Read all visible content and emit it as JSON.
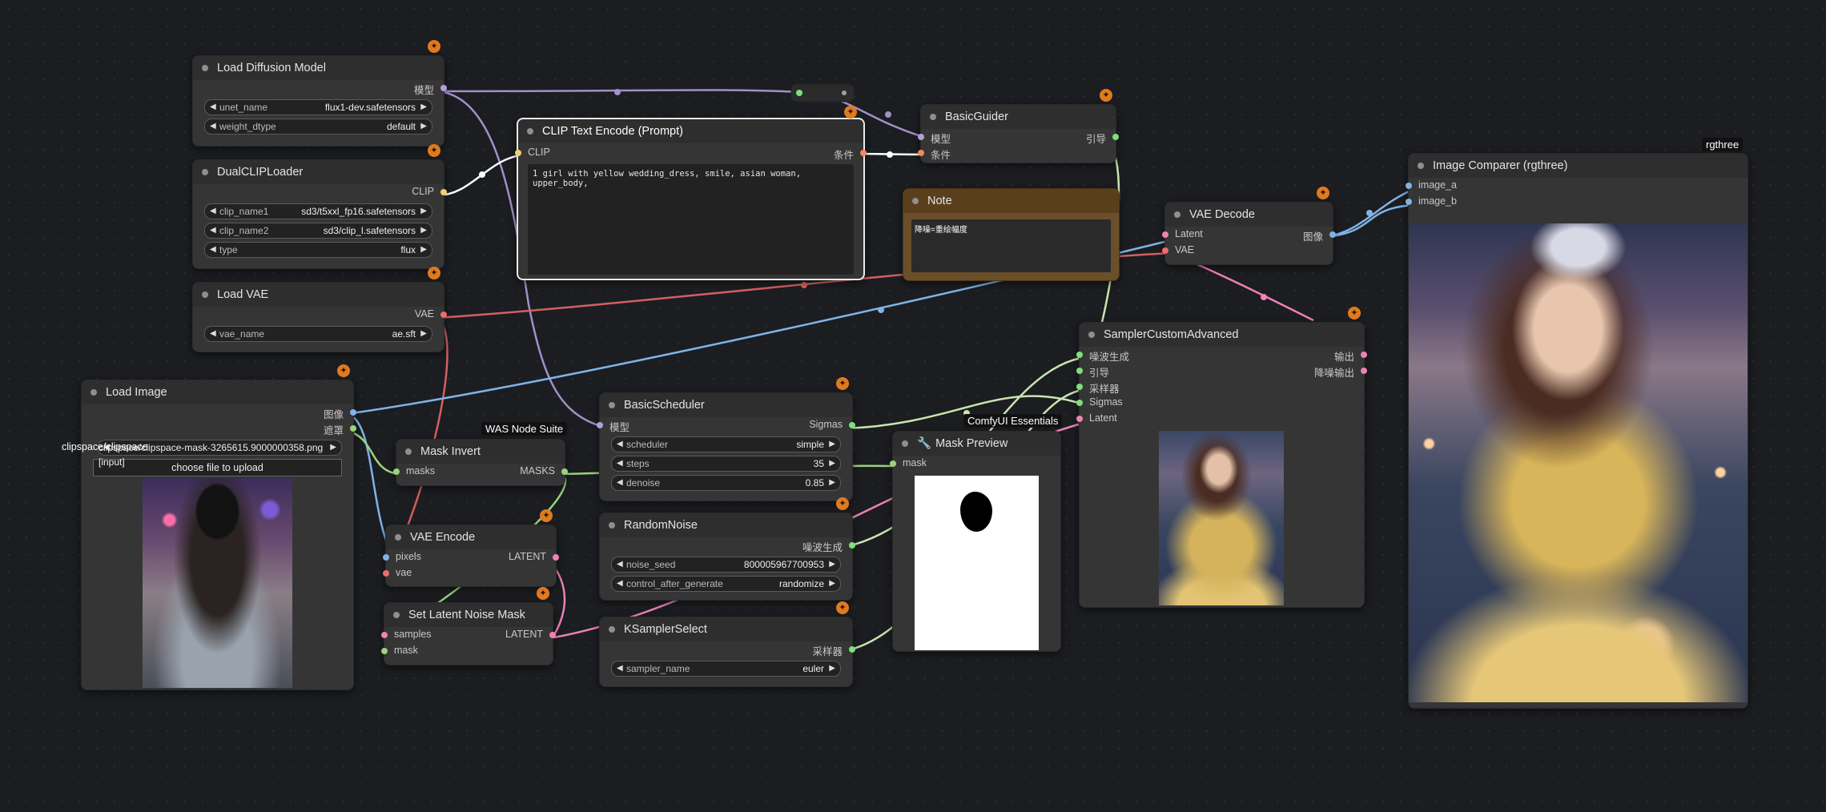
{
  "nodes": {
    "load_diffusion": {
      "title": "Load Diffusion Model",
      "out_model": "模型",
      "widgets": [
        {
          "name": "unet_name",
          "value": "flux1-dev.safetensors"
        },
        {
          "name": "weight_dtype",
          "value": "default"
        }
      ]
    },
    "dual_clip": {
      "title": "DualCLIPLoader",
      "out_clip": "CLIP",
      "widgets": [
        {
          "name": "clip_name1",
          "value": "sd3/t5xxl_fp16.safetensors"
        },
        {
          "name": "clip_name2",
          "value": "sd3/clip_l.safetensors"
        },
        {
          "name": "type",
          "value": "flux"
        }
      ]
    },
    "load_vae": {
      "title": "Load VAE",
      "out_vae": "VAE",
      "widgets": [
        {
          "name": "vae_name",
          "value": "ae.sft"
        }
      ]
    },
    "load_image": {
      "title": "Load Image",
      "out_image": "图像",
      "out_mask": "遮罩",
      "file_value": "clipspace/clipspace-mask-3265615.9000000358.png [input]",
      "file_overlap": "clipspace/clipspace",
      "upload_label": "choose file to upload"
    },
    "clip_text": {
      "title": "CLIP Text Encode (Prompt)",
      "in_clip": "CLIP",
      "out_cond": "条件",
      "text": "1 girl with yellow wedding_dress, smile, asian woman, upper_body,"
    },
    "note": {
      "title": "Note",
      "text": "降噪=重绘幅度"
    },
    "basic_guider": {
      "title": "BasicGuider",
      "in_model": "模型",
      "in_cond": "条件",
      "out_guider": "引导"
    },
    "vae_decode": {
      "title": "VAE Decode",
      "in_latent": "Latent",
      "in_vae": "VAE",
      "out_image": "图像"
    },
    "image_comparer": {
      "title": "Image Comparer (rgthree)",
      "in_a": "image_a",
      "in_b": "image_b",
      "tag": "rgthree"
    },
    "sampler_custom": {
      "title": "SamplerCustomAdvanced",
      "inputs": [
        "噪波生成",
        "引导",
        "采样器",
        "Sigmas",
        "Latent"
      ],
      "out_output": "输出",
      "out_denoised": "降噪输出",
      "tag": "ComfyUI Essentials"
    },
    "basic_scheduler": {
      "title": "BasicScheduler",
      "in_model": "模型",
      "out_sigmas": "Sigmas",
      "widgets": [
        {
          "name": "scheduler",
          "value": "simple"
        },
        {
          "name": "steps",
          "value": "35"
        },
        {
          "name": "denoise",
          "value": "0.85"
        }
      ]
    },
    "mask_invert": {
      "title": "Mask Invert",
      "in_masks": "masks",
      "out_masks": "MASKS",
      "tag": "WAS Node Suite"
    },
    "mask_preview": {
      "title": "Mask Preview",
      "in_mask": "mask"
    },
    "random_noise": {
      "title": "RandomNoise",
      "out_noise": "噪波生成",
      "widgets": [
        {
          "name": "noise_seed",
          "value": "800005967700953"
        },
        {
          "name": "control_after_generate",
          "value": "randomize"
        }
      ]
    },
    "vae_encode": {
      "title": "VAE Encode",
      "in_pixels": "pixels",
      "in_vae": "vae",
      "out_latent": "LATENT"
    },
    "set_latent_mask": {
      "title": "Set Latent Noise Mask",
      "in_samples": "samples",
      "in_mask": "mask",
      "out_latent": "LATENT"
    },
    "ksampler_select": {
      "title": "KSamplerSelect",
      "out_sampler": "采样器",
      "widgets": [
        {
          "name": "sampler_name",
          "value": "euler"
        }
      ]
    }
  },
  "colors": {
    "model": "#b39ddb",
    "clip": "#f0d06c",
    "vae": "#ef6b6b",
    "conditioning": "#f08a5d",
    "image": "#7fb3e6",
    "mask": "#9bd27c",
    "latent": "#ee82b6",
    "note": "#6b4f2a"
  }
}
